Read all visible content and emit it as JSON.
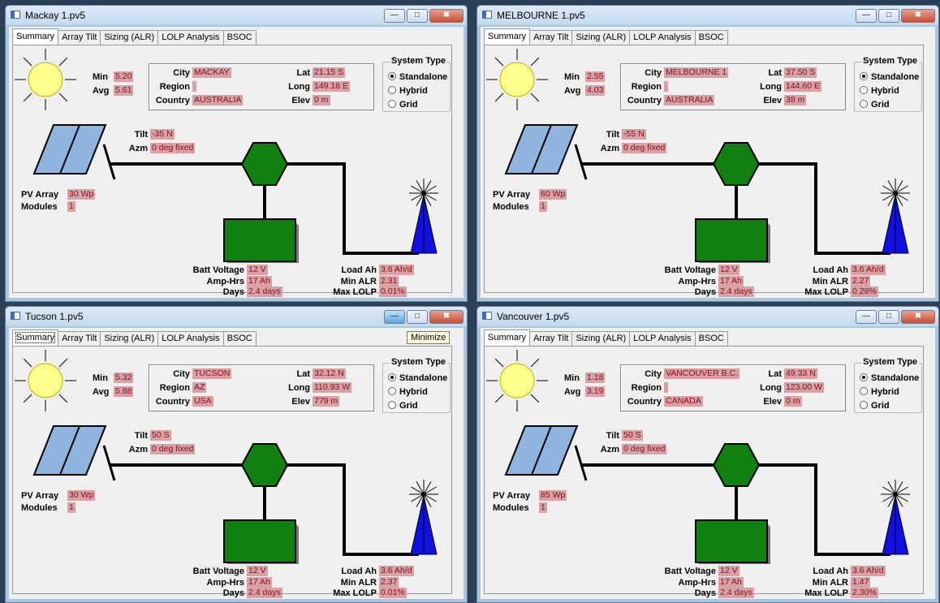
{
  "tabs": [
    "Summary",
    "Array Tilt",
    "Sizing (ALR)",
    "LOLP Analysis",
    "BSOC"
  ],
  "labels": {
    "min": "Min",
    "avg": "Avg",
    "city": "City",
    "region": "Region",
    "country": "Country",
    "lat": "Lat",
    "long": "Long",
    "elev": "Elev",
    "system_type": "System Type",
    "standalone": "Standalone",
    "hybrid": "Hybrid",
    "grid": "Grid",
    "tilt": "Tilt",
    "azm": "Azm",
    "pv_array": "PV Array",
    "modules": "Modules",
    "batt_voltage": "Batt Voltage",
    "amp_hrs": "Amp-Hrs",
    "days": "Days",
    "load_ah": "Load Ah",
    "min_alr": "Min ALR",
    "max_lolp": "Max LOLP"
  },
  "tooltip": "Minimize",
  "windows": [
    {
      "title": "Mackay 1.pv5",
      "min": "5.20",
      "avg": "5.61",
      "city": "MACKAY",
      "region": "",
      "country": "AUSTRALIA",
      "lat": "21.15 S",
      "long": "149.18 E",
      "elev": "0 m",
      "tilt": "-35 N",
      "azm": "0 deg fixed",
      "pv_array": "30 Wp",
      "modules": "1",
      "batt_voltage": "12 V",
      "amp_hrs": "17 Ah",
      "days": "2.4 days",
      "load_ah": "3.6 Ah/d",
      "min_alr": "2.31",
      "max_lolp": "0.01%"
    },
    {
      "title": "MELBOURNE 1.pv5",
      "min": "2.55",
      "avg": "4.03",
      "city": "MELBOURNE 1",
      "region": "",
      "country": "AUSTRALIA",
      "lat": "37.50 S",
      "long": "144.60 E",
      "elev": "38 m",
      "tilt": "-55 N",
      "azm": "0 deg fixed",
      "pv_array": "60 Wp",
      "modules": "1",
      "batt_voltage": "12 V",
      "amp_hrs": "17 Ah",
      "days": "2.4 days",
      "load_ah": "3.6 Ah/d",
      "min_alr": "2.27",
      "max_lolp": "0.28%"
    },
    {
      "title": "Tucson 1.pv5",
      "min": "5.32",
      "avg": "5.88",
      "city": "TUCSON",
      "region": "AZ",
      "country": "USA",
      "lat": "32.12 N",
      "long": "110.93 W",
      "elev": "779 m",
      "tilt": "50 S",
      "azm": "0 deg fixed",
      "pv_array": "30 Wp",
      "modules": "1",
      "batt_voltage": "12 V",
      "amp_hrs": "17 Ah",
      "days": "2.4 days",
      "load_ah": "3.6 Ah/d",
      "min_alr": "2.37",
      "max_lolp": "0.01%"
    },
    {
      "title": "Vancouver 1.pv5",
      "min": "1.18",
      "avg": "3.19",
      "city": "VANCOUVER B.C.",
      "region": "",
      "country": "CANADA",
      "lat": "49.33 N",
      "long": "123.00 W",
      "elev": "0 m",
      "tilt": "50 S",
      "azm": "0 deg fixed",
      "pv_array": "85 Wp",
      "modules": "1",
      "batt_voltage": "12 V",
      "amp_hrs": "17 Ah",
      "days": "2.4 days",
      "load_ah": "3.6 Ah/d",
      "min_alr": "1.47",
      "max_lolp": "2.30%"
    }
  ]
}
